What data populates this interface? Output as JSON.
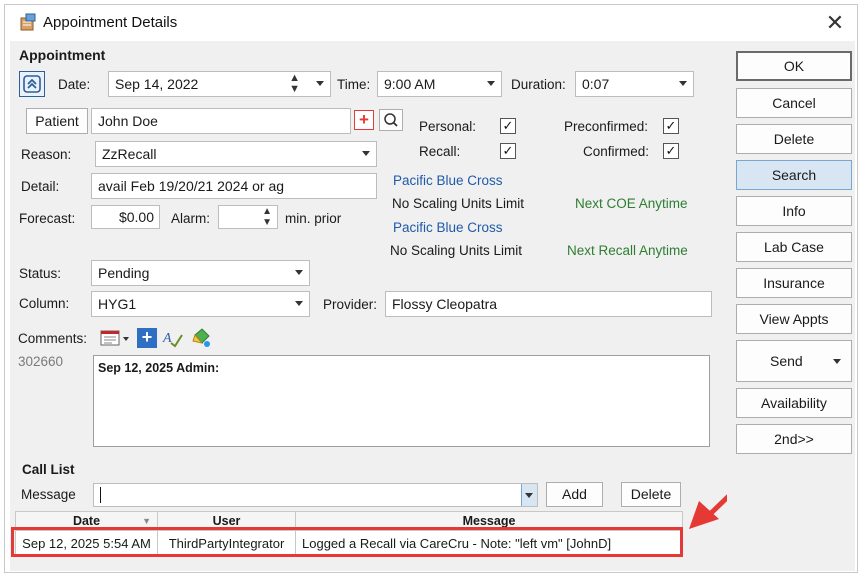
{
  "window": {
    "title": "Appointment Details",
    "close_glyph": "✕"
  },
  "appointment": {
    "section_label": "Appointment",
    "date_label": "Date:",
    "date_value": "Sep 14, 2022",
    "time_label": "Time:",
    "time_value": "9:00 AM",
    "duration_label": "Duration:",
    "duration_value": "0:07",
    "patient_button": "Patient",
    "patient_name": "John Doe",
    "reason_label": "Reason:",
    "reason_value": "ZzRecall",
    "detail_label": "Detail:",
    "detail_value": "avail Feb 19/20/21 2024 or  ag",
    "forecast_label": "Forecast:",
    "forecast_value": "$0.00",
    "alarm_label": "Alarm:",
    "alarm_value": "",
    "alarm_suffix": "min. prior",
    "status_label": "Status:",
    "status_value": "Pending",
    "column_label": "Column:",
    "column_value": "HYG1",
    "provider_label": "Provider:",
    "provider_value": "Flossy Cleopatra",
    "comments_label": "Comments:",
    "comment_id": "302660",
    "comment_text": "Sep 12, 2025 Admin:"
  },
  "flags": {
    "personal_label": "Personal:",
    "personal_checked": true,
    "preconfirmed_label": "Preconfirmed:",
    "preconfirmed_checked": true,
    "recall_label": "Recall:",
    "recall_checked": true,
    "confirmed_label": "Confirmed:",
    "confirmed_checked": true,
    "check_glyph": "✓"
  },
  "insurance": [
    {
      "name": "Pacific Blue Cross",
      "limit": "No Scaling Units Limit",
      "next": "Next COE Anytime"
    },
    {
      "name": "Pacific Blue Cross",
      "limit": "No Scaling Units Limit",
      "next": "Next Recall Anytime"
    }
  ],
  "call_list": {
    "section_label": "Call List",
    "message_label": "Message",
    "message_value": "",
    "add_button": "Add",
    "delete_button": "Delete",
    "columns": [
      "Date",
      "User",
      "Message"
    ],
    "rows": [
      {
        "date": "Sep 12, 2025 5:54 AM",
        "user": "ThirdPartyIntegrator",
        "message": "Logged a Recall via CareCru - Note: \"left vm\" [JohnD]"
      }
    ]
  },
  "side_buttons": {
    "ok": "OK",
    "cancel": "Cancel",
    "delete": "Delete",
    "search": "Search",
    "info": "Info",
    "lab_case": "Lab Case",
    "insurance": "Insurance",
    "view_appts": "View Appts",
    "send": "Send",
    "availability": "Availability",
    "second": "2nd>>"
  },
  "colors": {
    "accent_blue": "#1f5aa8",
    "green_text": "#2e7d32",
    "highlight_red": "#e53935",
    "search_active": "#d8e6f3",
    "plus_red": "#e53935"
  },
  "icons": [
    "appointment-icon",
    "collapse-up-icon",
    "add-patient-plus-icon",
    "search-icon",
    "calendar-list-icon",
    "add-blue-plus-icon",
    "spell-check-icon",
    "paint-bucket-icon",
    "red-arrow-annotation"
  ]
}
